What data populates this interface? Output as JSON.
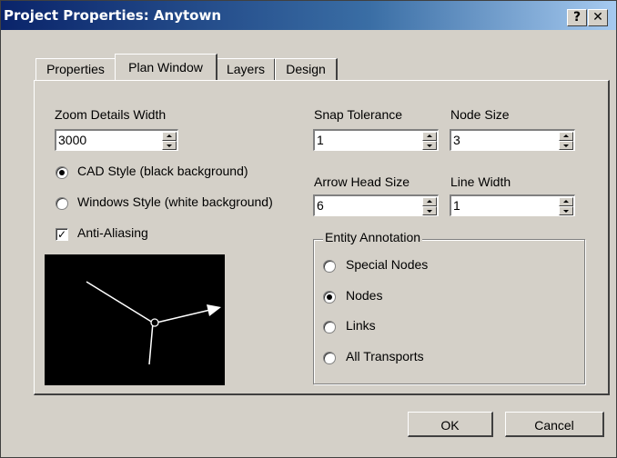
{
  "window": {
    "title": "Project Properties: Anytown",
    "help_label": "?",
    "close_label": "✕"
  },
  "tabs": [
    {
      "label": "Properties",
      "active": false
    },
    {
      "label": "Plan Window",
      "active": true
    },
    {
      "label": "Layers",
      "active": false
    },
    {
      "label": "Design",
      "active": false
    }
  ],
  "zoom": {
    "label": "Zoom Details Width",
    "value": "3000"
  },
  "snap": {
    "label": "Snap Tolerance",
    "value": "1"
  },
  "node_size": {
    "label": "Node Size",
    "value": "3"
  },
  "arrow": {
    "label": "Arrow Head Size",
    "value": "6"
  },
  "line_width": {
    "label": "Line Width",
    "value": "1"
  },
  "style_options": [
    {
      "label": "CAD Style (black background)",
      "selected": true
    },
    {
      "label": "Windows Style (white background)",
      "selected": false
    }
  ],
  "anti_aliasing": {
    "label": "Anti-Aliasing",
    "checked": true,
    "mark": "✓"
  },
  "annotation": {
    "title": "Entity Annotation",
    "options": [
      {
        "label": "Special Nodes",
        "selected": false
      },
      {
        "label": "Nodes",
        "selected": true
      },
      {
        "label": "Links",
        "selected": false
      },
      {
        "label": "All Transports",
        "selected": false
      }
    ]
  },
  "buttons": {
    "ok": "OK",
    "cancel": "Cancel"
  },
  "colors": {
    "title_start": "#0a246a",
    "title_end": "#a6caf0",
    "face": "#d4d0c8",
    "preview_bg": "#000000",
    "preview_line": "#ffffff"
  },
  "icons": [
    "help-icon",
    "close-icon",
    "spin-up-icon",
    "spin-down-icon",
    "node-circle-icon",
    "arrow-head-icon"
  ]
}
